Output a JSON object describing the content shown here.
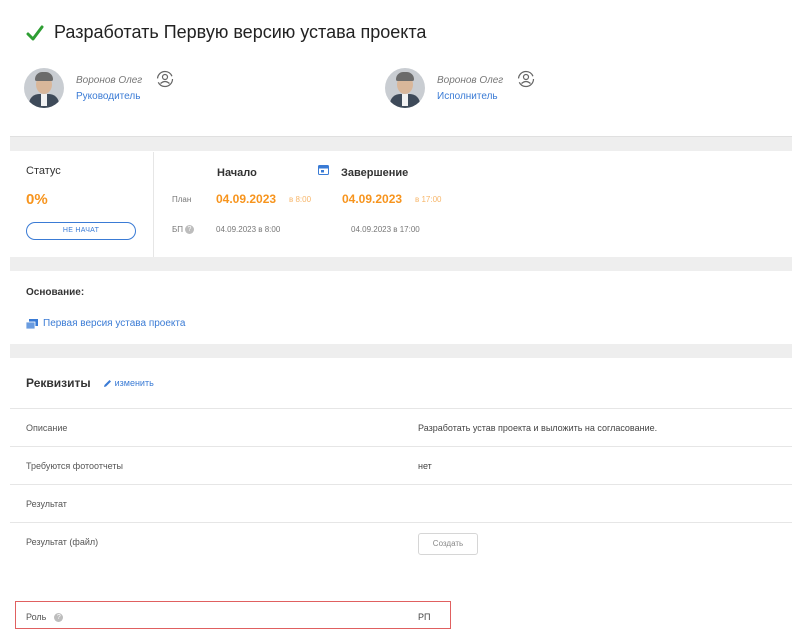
{
  "header": {
    "title": "Разработать Первую версию устава проекта",
    "people": [
      {
        "name": "Воронов Олег",
        "role": "Руководитель"
      },
      {
        "name": "Воронов Олег",
        "role": "Исполнитель"
      }
    ]
  },
  "status": {
    "label": "Статус",
    "percent": "0%",
    "badge": "НЕ НАЧАТ",
    "start_header": "Начало",
    "end_header": "Завершение",
    "plan_label": "План",
    "bp_label": "БП",
    "plan_start_date": "04.09.2023",
    "plan_start_time": "в 8:00",
    "plan_end_date": "04.09.2023",
    "plan_end_time": "в 17:00",
    "bp_start": "04.09.2023 в 8:00",
    "bp_end": "04.09.2023 в 17:00"
  },
  "basis": {
    "label": "Основание:",
    "link": "Первая версия устава проекта"
  },
  "details": {
    "title": "Реквизиты",
    "edit_label": "изменить",
    "rows": [
      {
        "label": "Описание",
        "value": "Разработать устав проекта и выложить на согласование."
      },
      {
        "label": "Требуются фотоотчеты",
        "value": "нет"
      },
      {
        "label": "Результат",
        "value": ""
      },
      {
        "label": "Результат (файл)",
        "value": ""
      }
    ],
    "create_button": "Создать",
    "role_label": "Роль",
    "role_value": "РП"
  },
  "colors": {
    "accent": "#3a7bd5",
    "orange": "#f7941d",
    "check": "#2e9e33",
    "highlight": "#e06060"
  }
}
